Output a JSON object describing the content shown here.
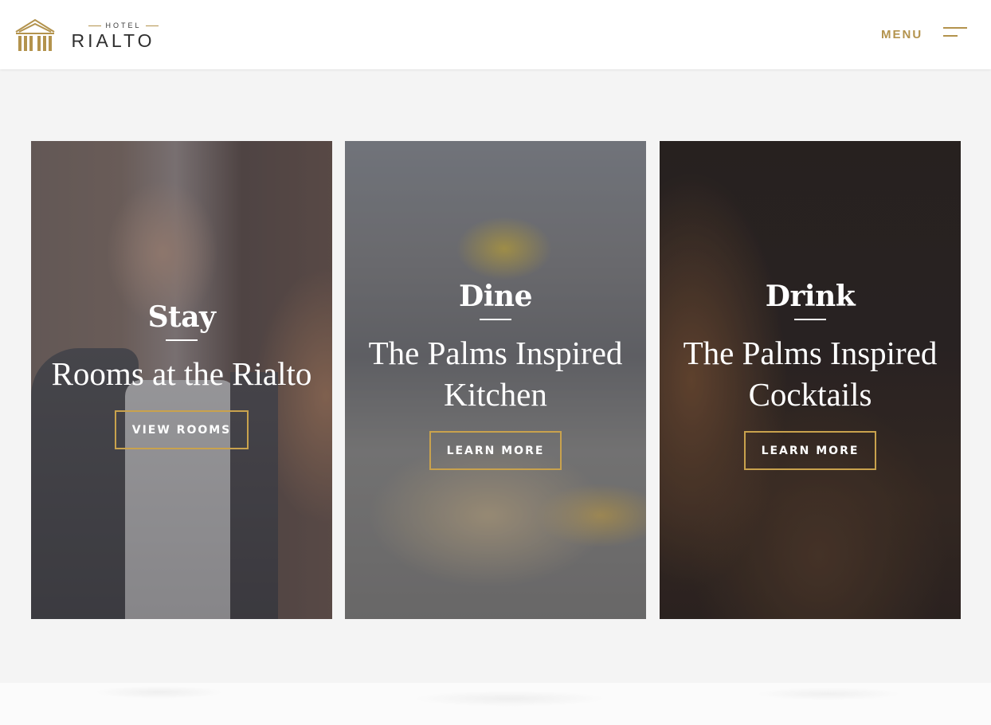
{
  "header": {
    "logo_small": "HOTEL",
    "logo_big": "RIALTO",
    "menu_label": "MENU"
  },
  "cards": [
    {
      "title": "Stay",
      "subtitle": "Rooms at the Rialto",
      "button": "VIEW ROOMS"
    },
    {
      "title": "Dine",
      "subtitle": "The Palms Inspired Kitchen",
      "button": "LEARN MORE"
    },
    {
      "title": "Drink",
      "subtitle": "The Palms Inspired Cocktails",
      "button": "LEARN MORE"
    }
  ],
  "colors": {
    "accent": "#b3934d",
    "button_border": "#c9a24d",
    "page_background": "#f4f4f4"
  },
  "icons": {
    "logo": "building-logo-icon",
    "menu": "hamburger-menu-icon"
  }
}
